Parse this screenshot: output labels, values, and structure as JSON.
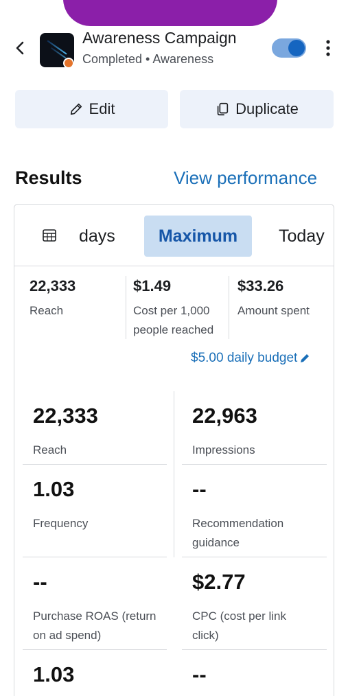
{
  "header": {
    "title": "Awareness Campaign",
    "status": "Completed",
    "separator": " • ",
    "objective": "Awareness",
    "toggle_on": true
  },
  "actions": {
    "edit_label": "Edit",
    "duplicate_label": "Duplicate"
  },
  "results": {
    "title": "Results",
    "view_performance_label": "View performance"
  },
  "date_range": {
    "options": [
      "days",
      "Maximum",
      "Today"
    ],
    "selected": "Maximum"
  },
  "summary": [
    {
      "value": "22,333",
      "label": "Reach"
    },
    {
      "value": "$1.49",
      "label": "Cost per 1,000 people reached"
    },
    {
      "value": "$33.26",
      "label": "Amount spent"
    }
  ],
  "budget": {
    "label": "$5.00 daily budget"
  },
  "metrics": [
    {
      "value": "22,333",
      "label": "Reach"
    },
    {
      "value": "22,963",
      "label": "Impressions"
    },
    {
      "value": "1.03",
      "label": "Frequency"
    },
    {
      "value": "--",
      "label": "Recommendation guidance"
    },
    {
      "value": "--",
      "label": "Purchase ROAS (return on ad spend)"
    },
    {
      "value": "$2.77",
      "label": "CPC (cost per link click)"
    },
    {
      "value": "1.03",
      "label": ""
    },
    {
      "value": "--",
      "label": ""
    }
  ],
  "colors": {
    "accent": "#1a6fb8",
    "selected_bg": "#c9ddf2",
    "status_dot": "#e4742c",
    "toggle_track": "#7aa7de",
    "toggle_knob": "#1565c0"
  }
}
